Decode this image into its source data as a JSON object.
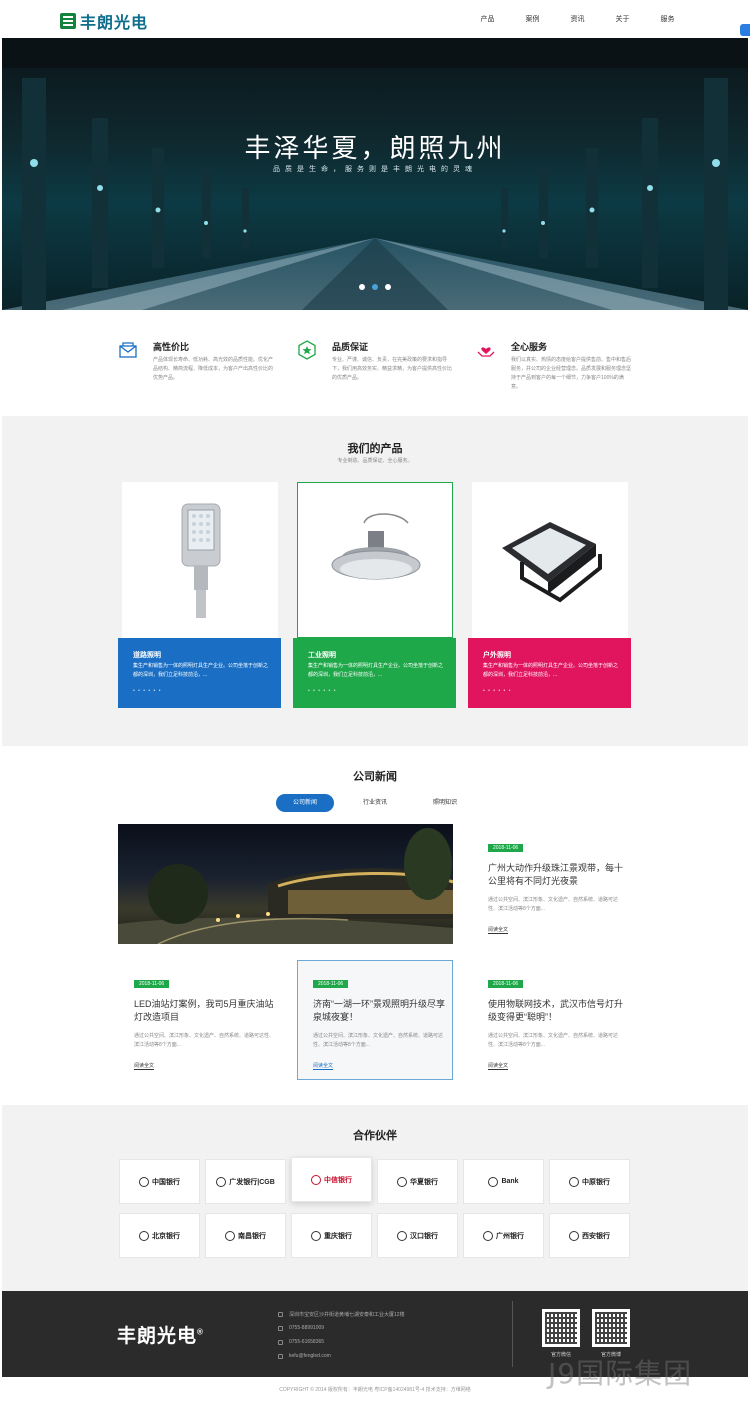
{
  "header": {
    "logo_text": "丰朗光电",
    "nav": [
      "产品",
      "案例",
      "资讯",
      "关于",
      "服务"
    ]
  },
  "hero": {
    "title": "丰泽华夏，朗照九州",
    "subtitle": "品质是生命，服务则是丰朗光电的灵魂",
    "slides": 3,
    "active_slide": 2
  },
  "features": [
    {
      "icon": "envelope-icon",
      "title": "高性价比",
      "desc": "产品体现长寿命、低功耗、高光效的品质性能。优化产品结构、精简流程、降低成本，为客户产出高性价比的优势产品。"
    },
    {
      "icon": "shield-star-icon",
      "title": "品质保证",
      "desc": "专业、严谨、诚信、负责，在完美政策的要求和指导下，我们用高效务实、精益求精，为客户提供高性价比的优质产品。"
    },
    {
      "icon": "hand-heart-icon",
      "title": "全心服务",
      "desc": "我们以真实、热情的态度给客户提供售前、售中和售后服务，并公司的企业经营理念。品质发展和服务理念坚持于产品到客户的每一个细节，力争客户100%的满意。"
    }
  ],
  "products": {
    "title": "我们的产品",
    "subtitle": "专业制造、品质保证、全心服务。",
    "items": [
      {
        "name": "道路照明",
        "desc": "集生产和销售为一体的照明灯具生产企业。公司坐落于创新之都的深圳，我们立足科技前沿，...",
        "color": "#1a6fc4",
        "image": "street-light"
      },
      {
        "name": "工业照明",
        "desc": "集生产和销售为一体的照明灯具生产企业。公司坐落于创新之都的深圳，我们立足科技前沿，...",
        "color": "#1fa84a",
        "image": "high-bay-light"
      },
      {
        "name": "户外照明",
        "desc": "集生产和销售为一体的照明灯具生产企业。公司坐落于创新之都的深圳，我们立足科技前沿，...",
        "color": "#e0155e",
        "image": "flood-light"
      }
    ],
    "dots": "• • • • • •"
  },
  "news": {
    "title": "公司新闻",
    "tabs": [
      "公司新闻",
      "行业资讯",
      "照明知识"
    ],
    "active_tab": 0,
    "featured": {
      "date": "2018-11-06",
      "title": "广州大动作升级珠江景观带，每十公里将有不同灯光夜景",
      "desc": "通过公共空间、滨江形象、文化遗产、自然系统、道路可达性、滨江活动等8个方面...",
      "more": "阅读全文"
    },
    "items": [
      {
        "date": "2018-11-06",
        "title": "LED油站灯案例，我司5月重庆油站灯改造项目",
        "desc": "通过公共空间、滨江形象、文化遗产、自然系统、道路可达性、滨江活动等8个方面...",
        "more": "阅读全文"
      },
      {
        "date": "2018-11-06",
        "title": "济南“一湖一环”景观照明升级尽享泉城夜宴！",
        "desc": "通过公共空间、滨江形象、文化遗产、自然系统、道路可达性、滨江活动等8个方面...",
        "more": "阅读全文"
      },
      {
        "date": "2018-11-06",
        "title": "使用物联网技术，武汉市信号灯升级变得更“聪明”！",
        "desc": "通过公共空间、滨江形象、文化遗产、自然系统、道路可达性、滨江活动等8个方面...",
        "more": "阅读全文"
      }
    ]
  },
  "partners": {
    "title": "合作伙伴",
    "logos": [
      "中国银行",
      "广发银行|CGB",
      "中信银行",
      "华夏银行",
      "Bank",
      "中原银行",
      "北京银行",
      "南昌银行",
      "重庆银行",
      "汉口银行",
      "广州银行",
      "西安银行"
    ]
  },
  "footer": {
    "logo": "丰朗光电",
    "reg": "®",
    "address": "深圳市宝安区沙井街道黄埔七湖安泰和工业大厦12楼",
    "phone1": "0755-88991009",
    "phone2": "0755-61658365",
    "email": "kefu@fengled.com",
    "qr1_label": "官方微信",
    "qr2_label": "官方微博"
  },
  "copyright": "COPYRIGHT © 2014   版权所有：丰朗光电   粤ICP备14024981号-4      技术支持：方维网络",
  "watermark": "J9国际集团"
}
